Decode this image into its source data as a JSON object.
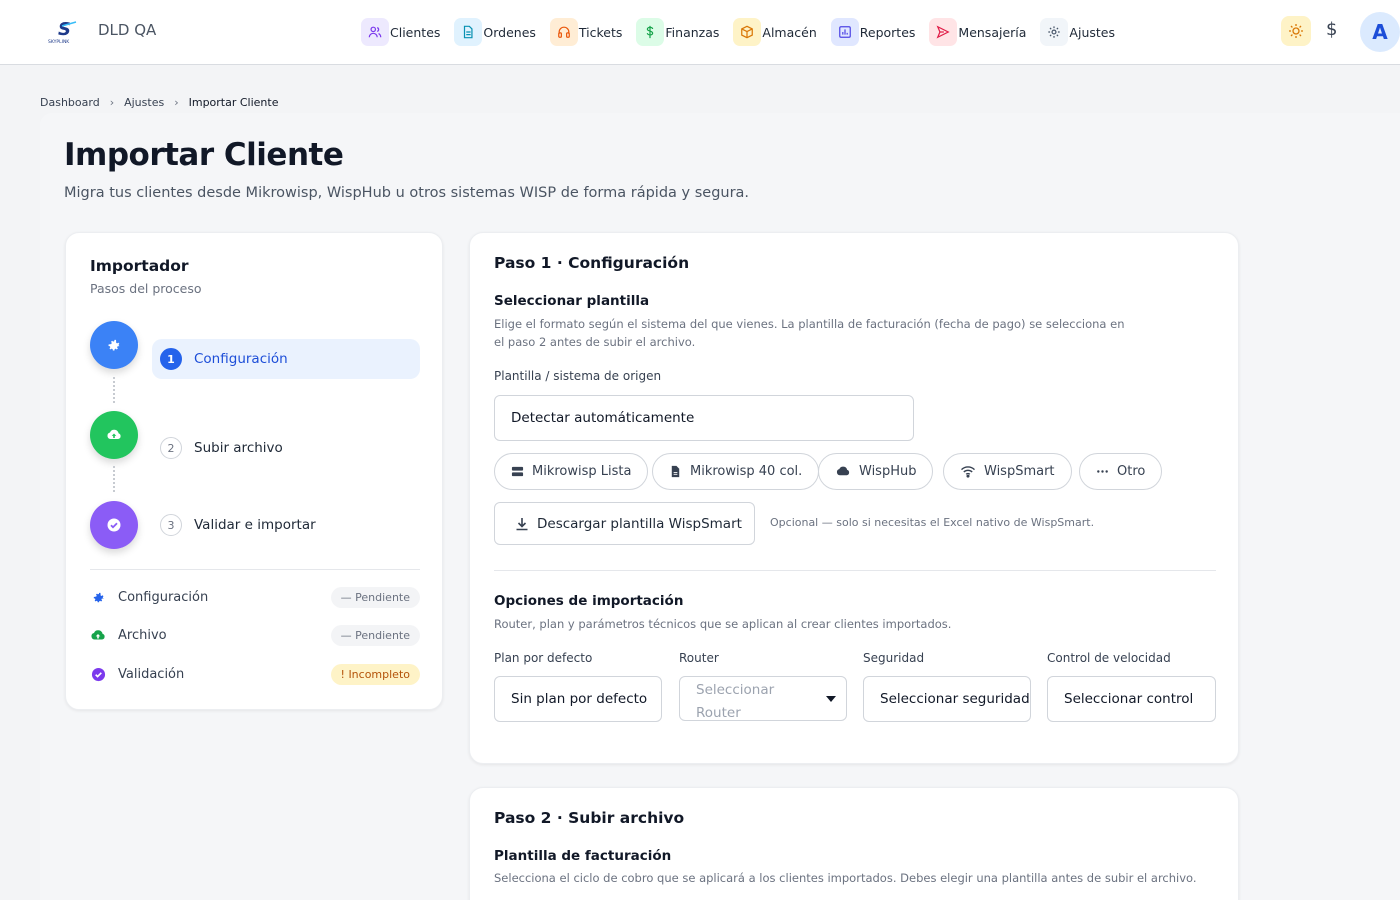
{
  "app": {
    "brand": "DLD QA",
    "logo_text": "S",
    "logo_subtext": "SKYPLINK"
  },
  "nav": [
    {
      "label": "Clientes",
      "icon": "users-icon",
      "bg": "#ede9fe",
      "color": "#7c3aed"
    },
    {
      "label": "Ordenes",
      "icon": "document-icon",
      "bg": "#e0f2fe",
      "color": "#0891b2"
    },
    {
      "label": "Tickets",
      "icon": "headset-icon",
      "bg": "#ffedd5",
      "color": "#ea580c"
    },
    {
      "label": "Finanzas",
      "icon": "dollar-icon",
      "bg": "#dcfce7",
      "color": "#16a34a"
    },
    {
      "label": "Almacén",
      "icon": "box-icon",
      "bg": "#fef3c7",
      "color": "#d97706"
    },
    {
      "label": "Reportes",
      "icon": "chart-icon",
      "bg": "#e0e7ff",
      "color": "#4f46e5"
    },
    {
      "label": "Mensajería",
      "icon": "send-icon",
      "bg": "#ffe4e6",
      "color": "#e11d48"
    },
    {
      "label": "Ajustes",
      "icon": "gear-icon",
      "bg": "#f1f5f9",
      "color": "#475569"
    }
  ],
  "topbar_right": {
    "currency_symbol": "$",
    "avatar_initial": "A"
  },
  "breadcrumb": [
    "Dashboard",
    "Ajustes",
    "Importar Cliente"
  ],
  "page": {
    "title": "Importar Cliente",
    "subtitle": "Migra tus clientes desde Mikrowisp, WispHub u otros sistemas WISP de forma rápida y segura."
  },
  "importer": {
    "title": "Importador",
    "subtitle": "Pasos del proceso",
    "steps": [
      {
        "num": "1",
        "label": "Configuración",
        "active": true,
        "color": "#3b82f6"
      },
      {
        "num": "2",
        "label": "Subir archivo",
        "active": false,
        "color": "#22c55e"
      },
      {
        "num": "3",
        "label": "Validar e importar",
        "active": false,
        "color": "#8b5cf6"
      }
    ],
    "status": [
      {
        "label": "Configuración",
        "badge": "— Pendiente",
        "warn": false
      },
      {
        "label": "Archivo",
        "badge": "— Pendiente",
        "warn": false
      },
      {
        "label": "Validación",
        "badge": "! Incompleto",
        "warn": true
      }
    ]
  },
  "step1": {
    "title": "Paso 1 · Configuración",
    "template_section": {
      "title": "Seleccionar plantilla",
      "desc_line1": "Elige el formato según el sistema del que vienes. La plantilla de facturación (fecha de pago) se selecciona en",
      "desc_line2": "el paso 2 antes de subir el archivo.",
      "field_label": "Plantilla / sistema de origen",
      "selected_value": "Detectar automáticamente",
      "options": [
        {
          "label": "Mikrowisp Lista",
          "icon": "server-icon"
        },
        {
          "label": "Mikrowisp 40 col.",
          "icon": "file-icon"
        },
        {
          "label": "WispHub",
          "icon": "cloud-icon"
        },
        {
          "label": "WispSmart",
          "icon": "wifi-icon"
        },
        {
          "label": "Otro",
          "icon": "dots-icon"
        }
      ],
      "download_label": "Descargar plantilla WispSmart",
      "download_note": "Opcional — solo si necesitas el Excel nativo de WispSmart."
    },
    "options_section": {
      "title": "Opciones de importación",
      "desc": "Router, plan y parámetros técnicos que se aplican al crear clientes importados.",
      "fields": [
        {
          "label": "Plan por defecto",
          "value": "Sin plan por defecto"
        },
        {
          "label": "Router",
          "value": "Seleccionar Router"
        },
        {
          "label": "Seguridad",
          "value": "Seleccionar seguridad"
        },
        {
          "label": "Control de velocidad",
          "value": "Seleccionar control"
        }
      ]
    }
  },
  "step2": {
    "title": "Paso 2 · Subir archivo",
    "section_title": "Plantilla de facturación",
    "desc": "Selecciona el ciclo de cobro que se aplicará a los clientes importados. Debes elegir una plantilla antes de subir el archivo."
  }
}
